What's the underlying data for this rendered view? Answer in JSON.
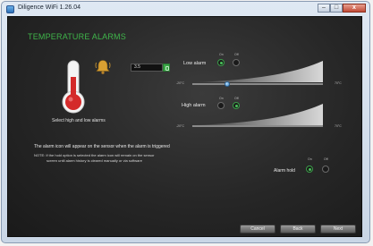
{
  "window": {
    "title": "Diligence WiFi 1.26.04",
    "minimize_label": "–",
    "maximize_label": "□",
    "close_label": "x"
  },
  "panel": {
    "heading": "TEMPERATURE ALARMS",
    "select_text": "Select high and low alarms",
    "hold_value": "3.5"
  },
  "low_alarm": {
    "label": "Low alarm",
    "on_label": "On",
    "off_label": "Off",
    "selected": "on",
    "min_label": "-20°C",
    "max_label": "70°C",
    "slider_fraction": 0.27
  },
  "high_alarm": {
    "label": "High alarm",
    "on_label": "On",
    "off_label": "Off",
    "selected": "on",
    "min_label": "-20°C",
    "max_label": "70°C"
  },
  "info": {
    "line1": "The alarm icon will appear on the sensor when the alarm is triggered",
    "note_line1": "NOTE: If the hold option is selected the alarm icon will remain on the sensor",
    "note_line2": "screen until alarm history is cleared manually or via software"
  },
  "alarm_hold": {
    "label": "Alarm hold",
    "on_label": "On",
    "off_label": "Off",
    "selected": "on"
  },
  "buttons": {
    "cancel": "Cancel",
    "back": "Back",
    "next": "Next"
  },
  "colors": {
    "accent_green": "#3fb54a",
    "thermometer_red": "#d42a2a",
    "bell_gold": "#d9a032",
    "slider_blue": "#3b88c9"
  }
}
